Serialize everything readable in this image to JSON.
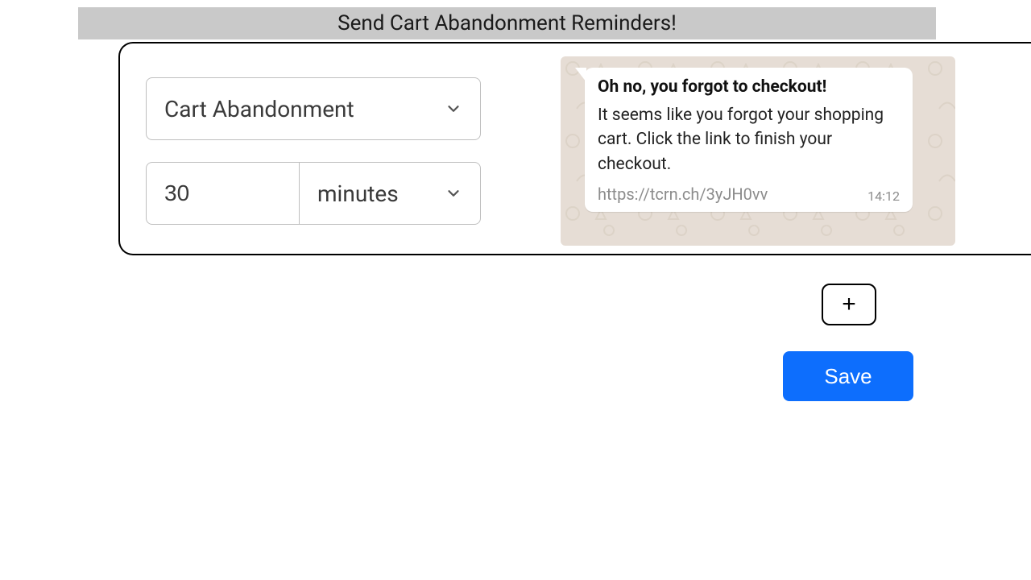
{
  "title": "Send Cart Abandonment Reminders!",
  "trigger": {
    "selected_label": "Cart Abandonment"
  },
  "delay": {
    "value": "30",
    "unit_label": "minutes"
  },
  "preview": {
    "message_title": "Oh no, you forgot to checkout!",
    "message_body": "It seems like you forgot your shopping cart. Click the link to finish your checkout.",
    "message_link": "https://tcrn.ch/3yJH0vv",
    "message_time": "14:12"
  },
  "icons": {
    "add": "+"
  },
  "actions": {
    "save_label": "Save"
  }
}
